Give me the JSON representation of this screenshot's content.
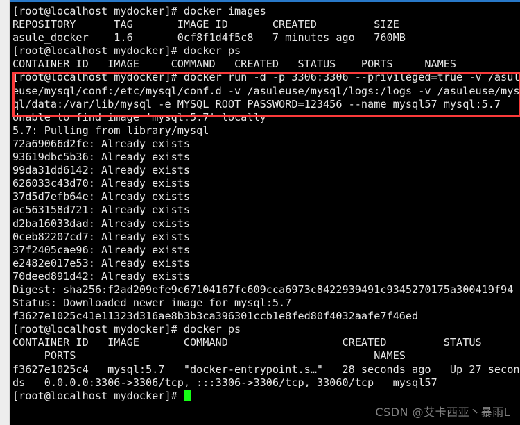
{
  "window": {
    "title": "Terminal — docker run mysql:5.7",
    "background_color": "#000000",
    "foreground_color": "#e6e6e6",
    "accent_rule_color": "#2878c8",
    "cursor_color": "#15ff15",
    "highlight_box_color": "#fb3a3a"
  },
  "prompt": {
    "text": "[root@localhost mydocker]#",
    "user": "root",
    "host": "localhost",
    "cwd": "mydocker"
  },
  "terminal": {
    "lines": [
      "[root@localhost mydocker]# docker images",
      "REPOSITORY      TAG       IMAGE ID       CREATED         SIZE",
      "asule_docker    1.6       0cf8f1d4f5c8   7 minutes ago   760MB",
      "[root@localhost mydocker]# docker ps",
      "CONTAINER ID   IMAGE     COMMAND   CREATED   STATUS    PORTS     NAMES",
      "[root@localhost mydocker]# docker run -d -p 3306:3306 --privileged=true -v /asul",
      "euse/mysql/conf:/etc/mysql/conf.d -v /asuleuse/mysql/logs:/logs -v /asuleuse/mys",
      "ql/data:/var/lib/mysql -e MYSQL_ROOT_PASSWORD=123456 --name mysql57 mysql:5.7",
      "Unable to find image 'mysql:5.7' locally",
      "5.7: Pulling from library/mysql",
      "72a69066d2fe: Already exists",
      "93619dbc5b36: Already exists",
      "99da31dd6142: Already exists",
      "626033c43d70: Already exists",
      "37d5d7efb64e: Already exists",
      "ac563158d721: Already exists",
      "d2ba16033dad: Already exists",
      "0ceb82207cd7: Already exists",
      "37f2405cae96: Already exists",
      "e2482e017e53: Already exists",
      "70deed891d42: Already exists",
      "Digest: sha256:f2ad209efe9c67104167fc609cca6973c8422939491c9345270175a300419f94",
      "Status: Downloaded newer image for mysql:5.7",
      "f3627e1025c41e11323d316ae8b3b3ca396301ccb1e8fed80f4032aafe7f46ed",
      "[root@localhost mydocker]# docker ps",
      "CONTAINER ID   IMAGE       COMMAND                  CREATED         STATUS",
      "     PORTS                                               NAMES",
      "f3627e1025c4   mysql:5.7   \"docker-entrypoint.s…\"   28 seconds ago   Up 27 secon",
      "ds   0.0.0.0:3306->3306/tcp, :::3306->3306/tcp, 33060/tcp   mysql57"
    ],
    "final_prompt": "[root@localhost mydocker]# "
  },
  "commands": {
    "docker_images": "docker images",
    "docker_ps": "docker ps",
    "docker_run": "docker run -d -p 3306:3306 --privileged=true -v /asuleuse/mysql/conf:/etc/mysql/conf.d -v /asuleuse/mysql/logs:/logs -v /asuleuse/mysql/data:/var/lib/mysql -e MYSQL_ROOT_PASSWORD=123456 --name mysql57 mysql:5.7"
  },
  "images_table": {
    "headers": [
      "REPOSITORY",
      "TAG",
      "IMAGE ID",
      "CREATED",
      "SIZE"
    ],
    "rows": [
      [
        "asule_docker",
        "1.6",
        "0cf8f1d4f5c8",
        "7 minutes ago",
        "760MB"
      ]
    ]
  },
  "ps_table_empty": {
    "headers": [
      "CONTAINER ID",
      "IMAGE",
      "COMMAND",
      "CREATED",
      "STATUS",
      "PORTS",
      "NAMES"
    ],
    "rows": []
  },
  "ps_table_final": {
    "headers": [
      "CONTAINER ID",
      "IMAGE",
      "COMMAND",
      "CREATED",
      "STATUS",
      "PORTS",
      "NAMES"
    ],
    "rows": [
      [
        "f3627e1025c4",
        "mysql:5.7",
        "\"docker-entrypoint.s…\"",
        "28 seconds ago",
        "Up 27 seconds",
        "0.0.0.0:3306->3306/tcp, :::3306->3306/tcp, 33060/tcp",
        "mysql57"
      ]
    ]
  },
  "pull_output": {
    "not_found": "Unable to find image 'mysql:5.7' locally",
    "pulling": "5.7: Pulling from library/mysql",
    "layers": [
      {
        "id": "72a69066d2fe",
        "status": "Already exists"
      },
      {
        "id": "93619dbc5b36",
        "status": "Already exists"
      },
      {
        "id": "99da31dd6142",
        "status": "Already exists"
      },
      {
        "id": "626033c43d70",
        "status": "Already exists"
      },
      {
        "id": "37d5d7efb64e",
        "status": "Already exists"
      },
      {
        "id": "ac563158d721",
        "status": "Already exists"
      },
      {
        "id": "d2ba16033dad",
        "status": "Already exists"
      },
      {
        "id": "0ceb82207cd7",
        "status": "Already exists"
      },
      {
        "id": "37f2405cae96",
        "status": "Already exists"
      },
      {
        "id": "e2482e017e53",
        "status": "Already exists"
      },
      {
        "id": "70deed891d42",
        "status": "Already exists"
      }
    ],
    "digest": "Digest: sha256:f2ad209efe9c67104167fc609cca6973c8422939491c9345270175a300419f94",
    "status": "Status: Downloaded newer image for mysql:5.7",
    "container_id": "f3627e1025c41e11323d316ae8b3b3ca396301ccb1e8fed80f4032aafe7f46ed"
  },
  "watermark": {
    "text": "CSDN @艾卡西亚丶暴雨L"
  }
}
